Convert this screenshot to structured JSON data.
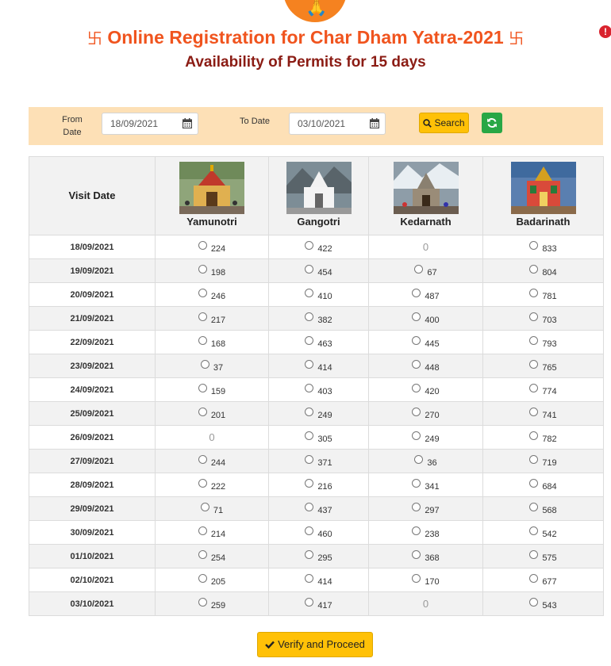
{
  "header": {
    "title": "Online Registration for Char Dham Yatra-2021",
    "title_symbol": "卐",
    "subtitle": "Availability of Permits for 15 days"
  },
  "filters": {
    "from_label": "From Date",
    "from_value": "18/09/2021",
    "to_label": "To Date",
    "to_value": "03/10/2021",
    "search_label": "Search"
  },
  "table": {
    "visit_date_header": "Visit Date",
    "temples": [
      "Yamunotri",
      "Gangotri",
      "Kedarnath",
      "Badarinath"
    ],
    "rows": [
      {
        "date": "18/09/2021",
        "values": [
          "224",
          "422",
          "0",
          "833"
        ]
      },
      {
        "date": "19/09/2021",
        "values": [
          "198",
          "454",
          "67",
          "804"
        ]
      },
      {
        "date": "20/09/2021",
        "values": [
          "246",
          "410",
          "487",
          "781"
        ]
      },
      {
        "date": "21/09/2021",
        "values": [
          "217",
          "382",
          "400",
          "703"
        ]
      },
      {
        "date": "22/09/2021",
        "values": [
          "168",
          "463",
          "445",
          "793"
        ]
      },
      {
        "date": "23/09/2021",
        "values": [
          "37",
          "414",
          "448",
          "765"
        ]
      },
      {
        "date": "24/09/2021",
        "values": [
          "159",
          "403",
          "420",
          "774"
        ]
      },
      {
        "date": "25/09/2021",
        "values": [
          "201",
          "249",
          "270",
          "741"
        ]
      },
      {
        "date": "26/09/2021",
        "values": [
          "0",
          "305",
          "249",
          "782"
        ]
      },
      {
        "date": "27/09/2021",
        "values": [
          "244",
          "371",
          "36",
          "719"
        ]
      },
      {
        "date": "28/09/2021",
        "values": [
          "222",
          "216",
          "341",
          "684"
        ]
      },
      {
        "date": "29/09/2021",
        "values": [
          "71",
          "437",
          "297",
          "568"
        ]
      },
      {
        "date": "30/09/2021",
        "values": [
          "214",
          "460",
          "238",
          "542"
        ]
      },
      {
        "date": "01/10/2021",
        "values": [
          "254",
          "295",
          "368",
          "575"
        ]
      },
      {
        "date": "02/10/2021",
        "values": [
          "205",
          "414",
          "170",
          "677"
        ]
      },
      {
        "date": "03/10/2021",
        "values": [
          "259",
          "417",
          "0",
          "543"
        ]
      }
    ]
  },
  "footer": {
    "verify_label": "Verify and Proceed"
  },
  "colors": {
    "title": "#f0541e",
    "subtitle": "#8b1c14",
    "date": "#e8341c",
    "filter_bar": "#fde0b6",
    "button_yellow": "#ffc107",
    "button_green": "#28a745"
  }
}
